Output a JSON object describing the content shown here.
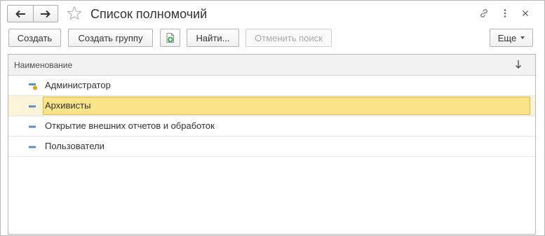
{
  "window": {
    "title": "Список полномочий"
  },
  "toolbar": {
    "create_label": "Создать",
    "create_group_label": "Создать группу",
    "find_label": "Найти...",
    "cancel_search_label": "Отменить поиск",
    "more_label": "Еще"
  },
  "table": {
    "column_header": "Наименование",
    "sort_direction": "descending",
    "rows": [
      {
        "name": "Администратор",
        "icon": "item-admin-icon",
        "selected": false
      },
      {
        "name": "Архивисты",
        "icon": "item-icon",
        "selected": true
      },
      {
        "name": "Открытие внешних отчетов и обработок",
        "icon": "item-icon",
        "selected": false
      },
      {
        "name": "Пользователи",
        "icon": "item-icon",
        "selected": false
      }
    ]
  },
  "colors": {
    "selection_fill": "#fce48a",
    "selection_border": "#e0b74a",
    "item_icon": "#5b8fbe",
    "admin_marker": "#e6a817",
    "add_icon_green": "#3aa84a"
  }
}
